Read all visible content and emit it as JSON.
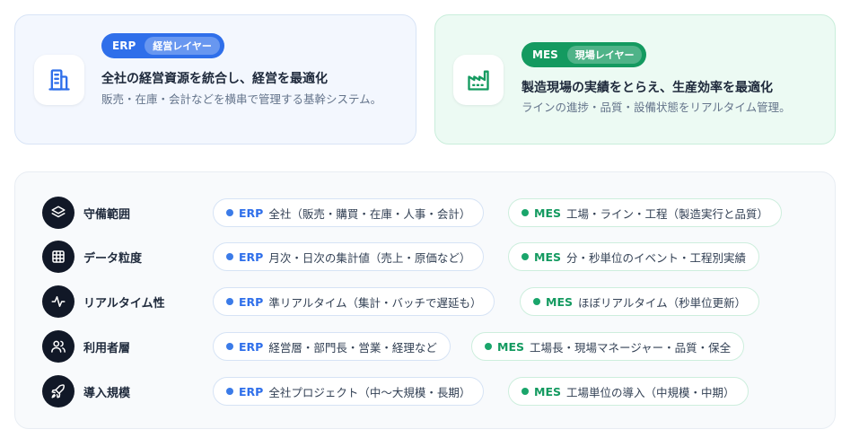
{
  "erp_card": {
    "badge": "ERP",
    "layer": "経営レイヤー",
    "title": "全社の経営資源を統合し、経営を最適化",
    "description": "販売・在庫・会計などを横串で管理する基幹システム。",
    "icon": "building-icon"
  },
  "mes_card": {
    "badge": "MES",
    "layer": "現場レイヤー",
    "title": "製造現場の実績をとらえ、生産効率を最適化",
    "description": "ラインの進捗・品質・設備状態をリアルタイム管理。",
    "icon": "factory-icon"
  },
  "colors": {
    "erp": "#2f6fea",
    "mes": "#149a60",
    "dark": "#111827"
  },
  "rows": [
    {
      "label": "守備範囲",
      "icon": "layers-icon",
      "erp": {
        "tag": "ERP",
        "text": "全社（販売・購買・在庫・人事・会計）"
      },
      "mes": {
        "tag": "MES",
        "text": "工場・ライン・工程（製造実行と品質）"
      }
    },
    {
      "label": "データ粒度",
      "icon": "grid-icon",
      "erp": {
        "tag": "ERP",
        "text": "月次・日次の集計値（売上・原価など）"
      },
      "mes": {
        "tag": "MES",
        "text": "分・秒単位のイベント・工程別実績"
      }
    },
    {
      "label": "リアルタイム性",
      "icon": "activity-icon",
      "erp": {
        "tag": "ERP",
        "text": "準リアルタイム（集計・バッチで遅延も）"
      },
      "mes": {
        "tag": "MES",
        "text": "ほぼリアルタイム（秒単位更新）"
      }
    },
    {
      "label": "利用者層",
      "icon": "users-icon",
      "erp": {
        "tag": "ERP",
        "text": "経営層・部門長・営業・経理など"
      },
      "mes": {
        "tag": "MES",
        "text": "工場長・現場マネージャー・品質・保全"
      }
    },
    {
      "label": "導入規模",
      "icon": "rocket-icon",
      "erp": {
        "tag": "ERP",
        "text": "全社プロジェクト（中〜大規模・長期）"
      },
      "mes": {
        "tag": "MES",
        "text": "工場単位の導入（中規模・中期）"
      }
    }
  ]
}
